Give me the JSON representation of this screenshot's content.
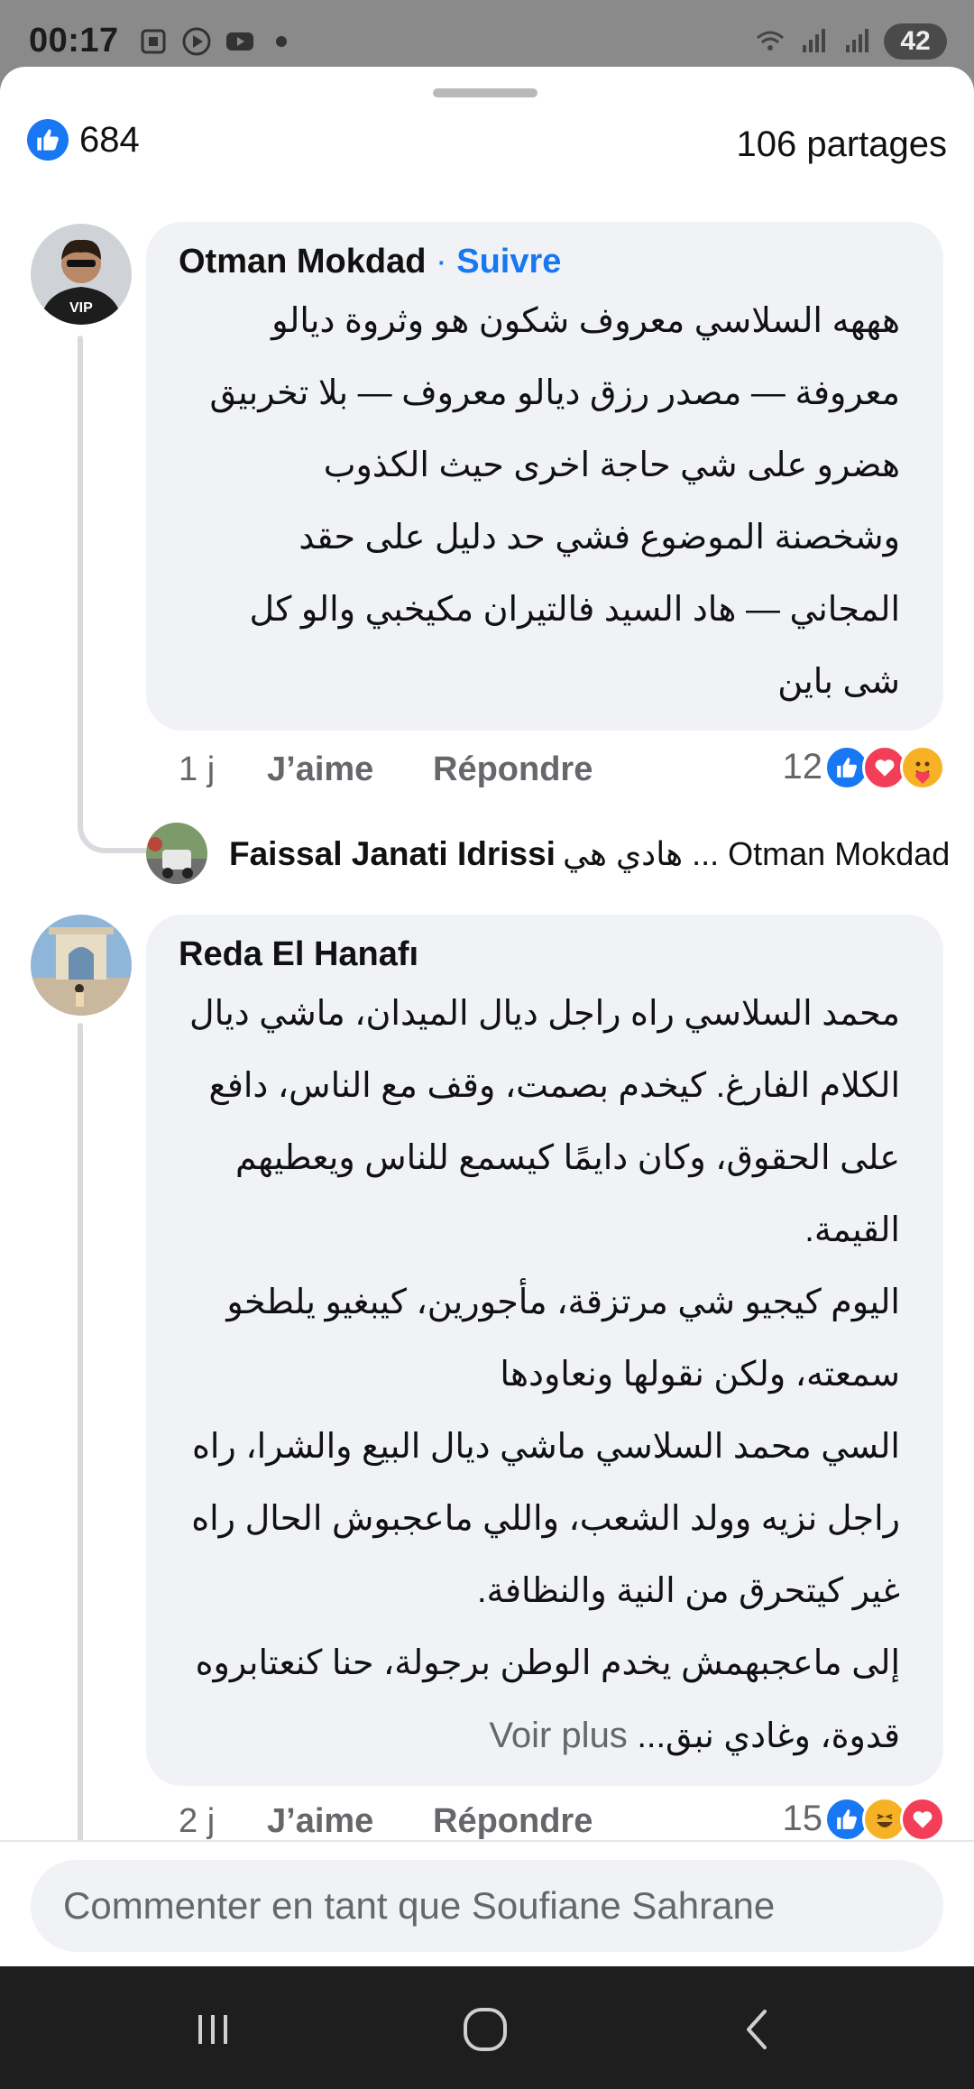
{
  "status_bar": {
    "time": "00:17",
    "battery": "42"
  },
  "stats": {
    "likes_count": "684",
    "shares": "106 partages"
  },
  "comments": [
    {
      "author": "Otman Mokdad",
      "separator": "·",
      "follow_label": "Suivre",
      "lines": [
        "هههه السلاسي معروف شكون هو وثروة ديالو",
        "معروفة  — مصدر رزق ديالو معروف — بلا تخربيق",
        "هضرو على شي حاجة اخرى  حيث الكذوب",
        "وشخصنة الموضوع فشي حد دليل على حقد",
        "المجاني — هاد السيد  فالتيران مكيخبي والو كل",
        "شى باين"
      ],
      "time": "1 j",
      "like_label": "J’aime",
      "reply_label": "Répondre",
      "reaction_count": "12",
      "reactions": [
        "like-reaction-icon",
        "love-reaction-icon",
        "care-reaction-icon"
      ]
    },
    {
      "author": "Reda El Hanafı",
      "lines": [
        "محمد السلاسي راه راجل ديال الميدان، ماشي ديال",
        "الكلام الفارغ. كيخدم بصمت، وقف مع الناس، دافع",
        "على الحقوق، وكان دايمًا كيسمع للناس ويعطيهم",
        "القيمة.",
        "اليوم كيجيو شي مرتزقة، مأجورين، كيبغيو يلطخو",
        "سمعته، ولكن نقولها ونعاودها",
        "السي محمد السلاسي ماشي ديال البيع والشرا، راه",
        "راجل نزيه وولد الشعب، واللي ماعجبوش الحال راه",
        "غير كيتحرق من النية والنظافة.",
        "إلى ماعجبهمش يخدم الوطن برجولة، حنا كنعتابروه"
      ],
      "last_line": "قدوة، وغادي نبق...",
      "see_more": "Voir plus",
      "time": "2 j",
      "like_label": "J’aime",
      "reply_label": "Répondre",
      "reaction_count": "15",
      "reactions": [
        "like-reaction-icon",
        "haha-reaction-icon",
        "love-reaction-icon"
      ]
    }
  ],
  "reply_preview": {
    "author": "Faissal Janati Idrissi",
    "text": "هادي هي ... Otman Mokdad"
  },
  "composer": {
    "placeholder": "Commenter en tant que Soufiane Sahrane"
  },
  "colors": {
    "accent": "#1877f2",
    "bubble": "#f0f2f5",
    "secondary_text": "#65676b"
  }
}
